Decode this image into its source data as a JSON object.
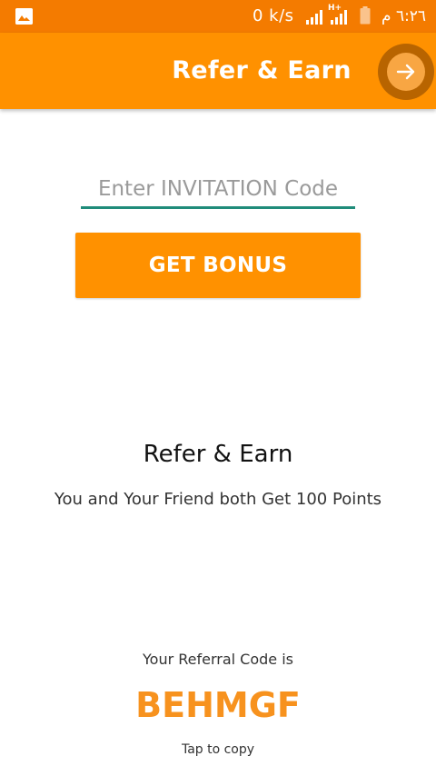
{
  "status_bar": {
    "network_speed": "0 k/s",
    "network_type": "H+",
    "time": "٦:٢٦ م",
    "icons": [
      "gallery-icon",
      "signal-icon",
      "battery-icon"
    ]
  },
  "app_bar": {
    "title": "Refer & Earn",
    "next_icon": "arrow-right-icon"
  },
  "invite_form": {
    "code_placeholder": "Enter INVITATION Code",
    "code_value": "",
    "button_label": "GET BONUS"
  },
  "promo": {
    "heading": "Refer & Earn",
    "subtitle": "You and Your Friend both Get 100 Points"
  },
  "referral": {
    "label": "Your Referral Code is",
    "code": "BEHMGF",
    "hint": "Tap to copy"
  },
  "colors": {
    "status_bar": "#f47b00",
    "app_bar": "#ff9100",
    "button": "#ff9100",
    "input_underline": "#1f8c7a",
    "referral_code": "#f7921e"
  }
}
